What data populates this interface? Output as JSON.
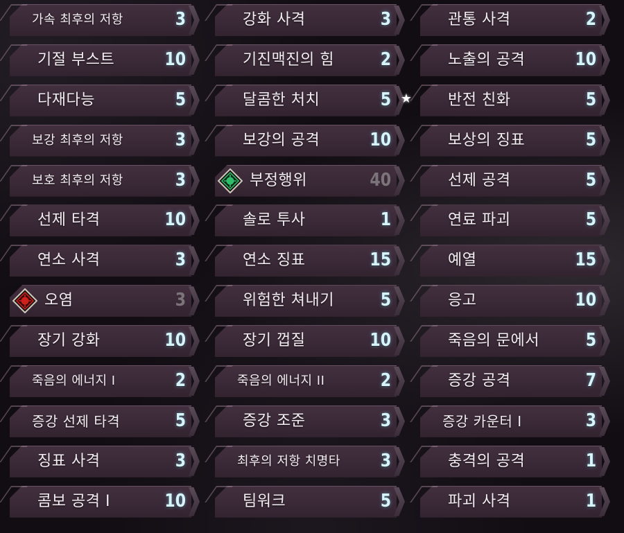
{
  "colors": {
    "plate": "#3a2937",
    "name_text": "#f3eef2",
    "level_text": "#d8f4fb",
    "level_dim": "#7b7579",
    "emblem_green": "#2fbf6a",
    "emblem_red": "#d0201c"
  },
  "columns": [
    {
      "skills": [
        {
          "name": "가속 최후의 저항",
          "level": "3"
        },
        {
          "name": "기절 부스트",
          "level": "10"
        },
        {
          "name": "다재다능",
          "level": "5"
        },
        {
          "name": "보강 최후의 저항",
          "level": "3"
        },
        {
          "name": "보호 최후의 저항",
          "level": "3"
        },
        {
          "name": "선제 타격",
          "level": "10"
        },
        {
          "name": "연소 사격",
          "level": "3"
        },
        {
          "name": "오염",
          "level": "3",
          "emblem": "red-diamond-icon",
          "dim": true
        },
        {
          "name": "장기 강화",
          "level": "10"
        },
        {
          "name": "죽음의 에너지 I",
          "level": "2"
        },
        {
          "name": "증강 선제 타격",
          "level": "5"
        },
        {
          "name": "징표 사격",
          "level": "3"
        },
        {
          "name": "콤보 공격 I",
          "level": "10"
        }
      ]
    },
    {
      "skills": [
        {
          "name": "강화 사격",
          "level": "3"
        },
        {
          "name": "기진맥진의 힘",
          "level": "2"
        },
        {
          "name": "달콤한 처치",
          "level": "5",
          "star": "★"
        },
        {
          "name": "보강의 공격",
          "level": "10"
        },
        {
          "name": "부정행위",
          "level": "40",
          "emblem": "green-diamond-icon",
          "dim": true
        },
        {
          "name": "솔로 투사",
          "level": "1"
        },
        {
          "name": "연소 징표",
          "level": "15"
        },
        {
          "name": "위험한 쳐내기",
          "level": "5"
        },
        {
          "name": "장기 껍질",
          "level": "10"
        },
        {
          "name": "죽음의 에너지 II",
          "level": "2"
        },
        {
          "name": "증강 조준",
          "level": "3"
        },
        {
          "name": "최후의 저항 치명타",
          "level": "3"
        },
        {
          "name": "팀워크",
          "level": "5"
        }
      ]
    },
    {
      "skills": [
        {
          "name": "관통 사격",
          "level": "2"
        },
        {
          "name": "노출의 공격",
          "level": "10"
        },
        {
          "name": "반전 친화",
          "level": "5"
        },
        {
          "name": "보상의 징표",
          "level": "5"
        },
        {
          "name": "선제 공격",
          "level": "5"
        },
        {
          "name": "연료 파괴",
          "level": "5"
        },
        {
          "name": "예열",
          "level": "15"
        },
        {
          "name": "응고",
          "level": "10"
        },
        {
          "name": "죽음의 문에서",
          "level": "5"
        },
        {
          "name": "증강 공격",
          "level": "7"
        },
        {
          "name": "증강 카운터 I",
          "level": "3"
        },
        {
          "name": "충격의 공격",
          "level": "1"
        },
        {
          "name": "파괴 사격",
          "level": "1"
        }
      ]
    }
  ]
}
